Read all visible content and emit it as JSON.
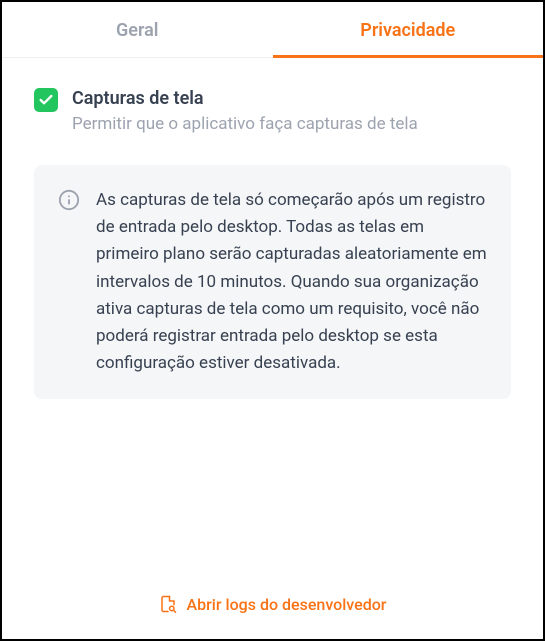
{
  "tabs": {
    "general": {
      "label": "Geral"
    },
    "privacy": {
      "label": "Privacidade"
    }
  },
  "setting": {
    "title": "Capturas de tela",
    "description": "Permitir que o aplicativo faça capturas de tela"
  },
  "info": {
    "text": "As capturas de tela só começarão após um registro de entrada pelo desktop. Todas as telas em primeiro plano serão capturadas aleatoriamente em intervalos de 10 minutos. Quando sua organização ativa capturas de tela como um requisito, você não poderá registrar entrada pelo desktop se esta configuração estiver desativada."
  },
  "footer": {
    "dev_logs_label": "Abrir logs do desenvolvedor"
  },
  "colors": {
    "accent": "#f97316",
    "success": "#22c55e"
  }
}
